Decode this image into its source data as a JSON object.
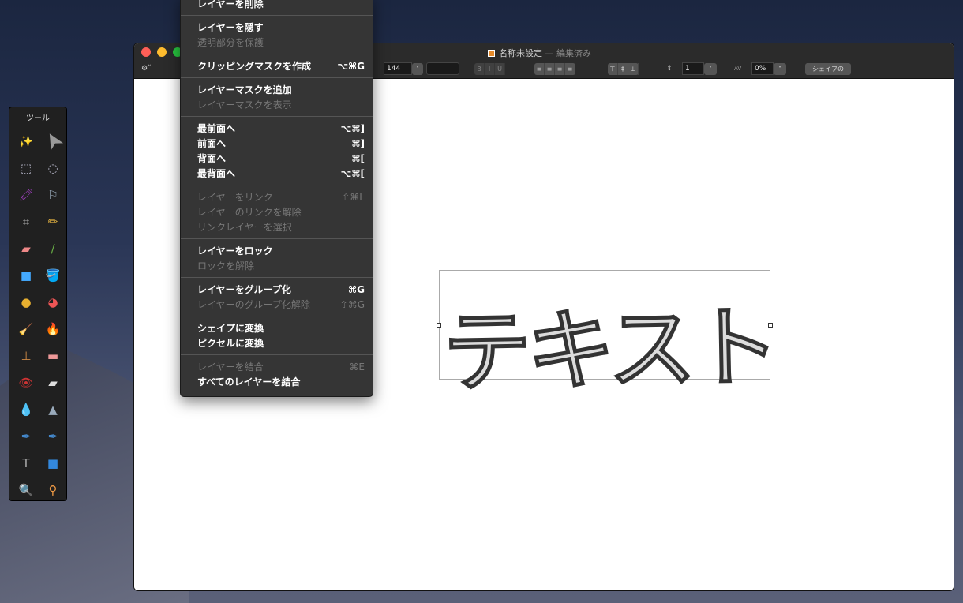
{
  "window": {
    "title": "名称未設定",
    "edited": "— 編集済み"
  },
  "toolbar": {
    "font_size": "144",
    "line_spacing": "1",
    "tracking": "0%",
    "shape_button": "シェイプの",
    "bold": "B",
    "italic": "I",
    "underline": "U"
  },
  "menu": [
    [
      {
        "label": "レイヤーを削除",
        "enabled": true,
        "shortcut": ""
      }
    ],
    [
      {
        "label": "レイヤーを隠す",
        "enabled": true,
        "shortcut": ""
      },
      {
        "label": "透明部分を保護",
        "enabled": false,
        "shortcut": ""
      }
    ],
    [
      {
        "label": "クリッピングマスクを作成",
        "enabled": true,
        "shortcut": "⌥⌘G"
      }
    ],
    [
      {
        "label": "レイヤーマスクを追加",
        "enabled": true,
        "shortcut": ""
      },
      {
        "label": "レイヤーマスクを表示",
        "enabled": false,
        "shortcut": ""
      }
    ],
    [
      {
        "label": "最前面へ",
        "enabled": true,
        "shortcut": "⌥⌘]"
      },
      {
        "label": "前面へ",
        "enabled": true,
        "shortcut": "⌘]"
      },
      {
        "label": "背面へ",
        "enabled": true,
        "shortcut": "⌘["
      },
      {
        "label": "最背面へ",
        "enabled": true,
        "shortcut": "⌥⌘["
      }
    ],
    [
      {
        "label": "レイヤーをリンク",
        "enabled": false,
        "shortcut": "⇧⌘L"
      },
      {
        "label": "レイヤーのリンクを解除",
        "enabled": false,
        "shortcut": ""
      },
      {
        "label": "リンクレイヤーを選択",
        "enabled": false,
        "shortcut": ""
      }
    ],
    [
      {
        "label": "レイヤーをロック",
        "enabled": true,
        "shortcut": ""
      },
      {
        "label": "ロックを解除",
        "enabled": false,
        "shortcut": ""
      }
    ],
    [
      {
        "label": "レイヤーをグループ化",
        "enabled": true,
        "shortcut": "⌘G"
      },
      {
        "label": "レイヤーのグループ化解除",
        "enabled": false,
        "shortcut": "⇧⌘G"
      }
    ],
    [
      {
        "label": "シェイプに変換",
        "enabled": true,
        "shortcut": ""
      },
      {
        "label": "ピクセルに変換",
        "enabled": true,
        "shortcut": ""
      }
    ],
    [
      {
        "label": "レイヤーを結合",
        "enabled": false,
        "shortcut": "⌘E"
      },
      {
        "label": "すべてのレイヤーを結合",
        "enabled": true,
        "shortcut": ""
      }
    ]
  ],
  "palette": {
    "title": "ツール",
    "tools": [
      {
        "name": "magic-wand",
        "glyph": "✨",
        "color": "#c040c0"
      },
      {
        "name": "arrow",
        "glyph": "➤",
        "color": "#999"
      },
      {
        "name": "rect-select",
        "glyph": "⬚",
        "color": "#aab"
      },
      {
        "name": "ellipse-select",
        "glyph": "◌",
        "color": "#aab"
      },
      {
        "name": "magic-brush",
        "glyph": "🖍",
        "color": "#a040c0"
      },
      {
        "name": "lasso",
        "glyph": "⚐",
        "color": "#9ab"
      },
      {
        "name": "crop",
        "glyph": "⌗",
        "color": "#aaa"
      },
      {
        "name": "pencil",
        "glyph": "✏",
        "color": "#e0b040"
      },
      {
        "name": "eraser",
        "glyph": "▰",
        "color": "#e88"
      },
      {
        "name": "brush",
        "glyph": "/",
        "color": "#6a4"
      },
      {
        "name": "rectangle",
        "glyph": "■",
        "color": "#4af"
      },
      {
        "name": "paint-bucket",
        "glyph": "🪣",
        "color": "#aaa"
      },
      {
        "name": "cloner",
        "glyph": "●",
        "color": "#e8b030"
      },
      {
        "name": "color-picker",
        "glyph": "◕",
        "color": "#e55"
      },
      {
        "name": "smudge",
        "glyph": "🧹",
        "color": "#e8a030"
      },
      {
        "name": "burn",
        "glyph": "🔥",
        "color": "#f60"
      },
      {
        "name": "stamp",
        "glyph": "⊥",
        "color": "#c84"
      },
      {
        "name": "bandage",
        "glyph": "▬",
        "color": "#e99"
      },
      {
        "name": "red-eye",
        "glyph": "👁",
        "color": "#c33"
      },
      {
        "name": "soft-eraser",
        "glyph": "▰",
        "color": "#ddd"
      },
      {
        "name": "blur",
        "glyph": "💧",
        "color": "#8ac"
      },
      {
        "name": "sharpen",
        "glyph": "▲",
        "color": "#9ab"
      },
      {
        "name": "pen",
        "glyph": "✒",
        "color": "#48c"
      },
      {
        "name": "freeform-pen",
        "glyph": "✒",
        "color": "#48c"
      },
      {
        "name": "text",
        "glyph": "T",
        "color": "#aaa"
      },
      {
        "name": "shape",
        "glyph": "■",
        "color": "#38d"
      },
      {
        "name": "zoom",
        "glyph": "🔍",
        "color": "#aaa"
      },
      {
        "name": "eyedropper",
        "glyph": "⚲",
        "color": "#e94"
      }
    ]
  },
  "canvas": {
    "text": "テキスト"
  }
}
